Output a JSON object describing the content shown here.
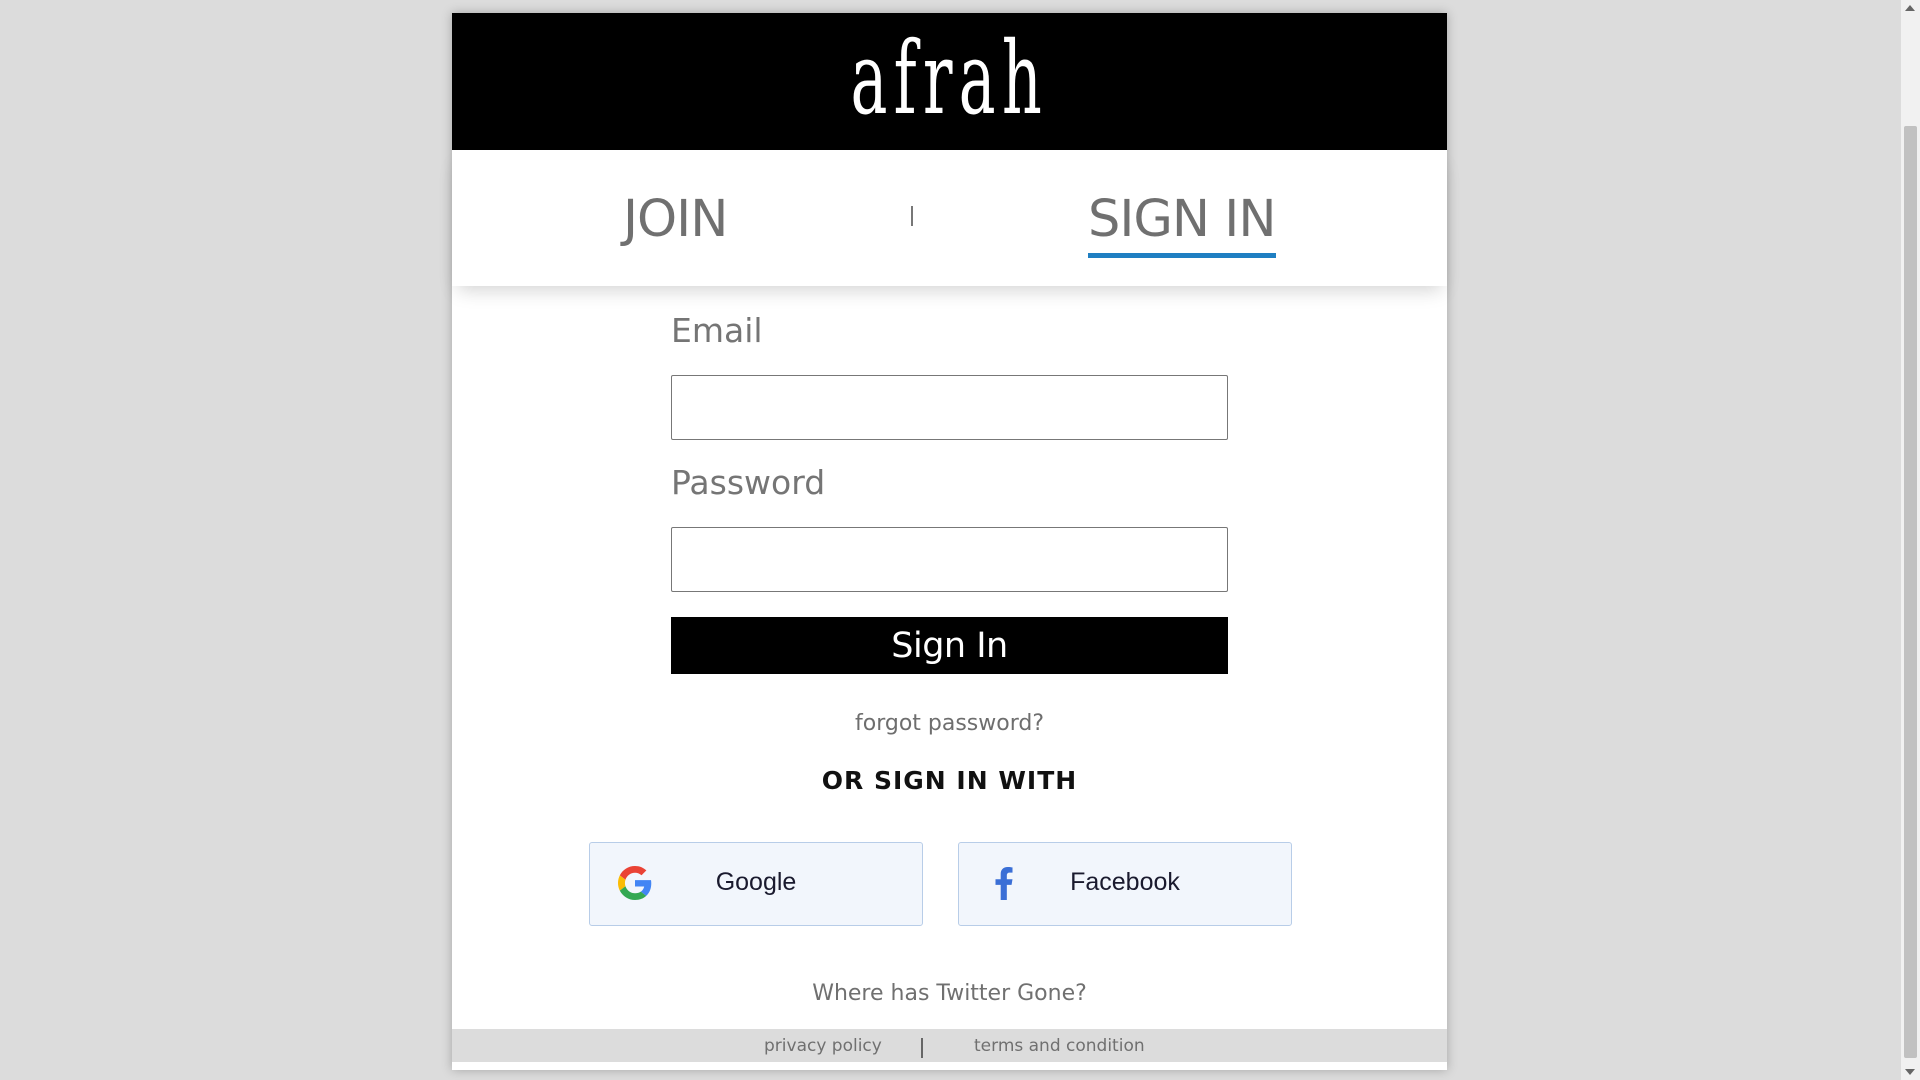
{
  "brand": {
    "logo_text": "afrah"
  },
  "tabs": [
    {
      "label": "JOIN",
      "active": false
    },
    {
      "label": "SIGN IN",
      "active": true
    }
  ],
  "form": {
    "email_label": "Email",
    "email_value": "",
    "password_label": "Password",
    "password_value": "",
    "submit_label": "Sign In",
    "forgot_label": "forgot password?"
  },
  "social": {
    "heading": "OR SIGN IN WITH",
    "google_label": "Google",
    "facebook_label": "Facebook"
  },
  "twitter_note": "Where has Twitter Gone?",
  "footer": {
    "privacy_label": "privacy policy",
    "terms_label": "terms and condition"
  },
  "colors": {
    "accent": "#1f7fc2",
    "brand_bar": "#000000",
    "page_bg": "#dcdcdc",
    "social_bg": "#f2f6fc"
  },
  "icons": {
    "google": "google-g-icon",
    "facebook": "facebook-f-icon"
  }
}
